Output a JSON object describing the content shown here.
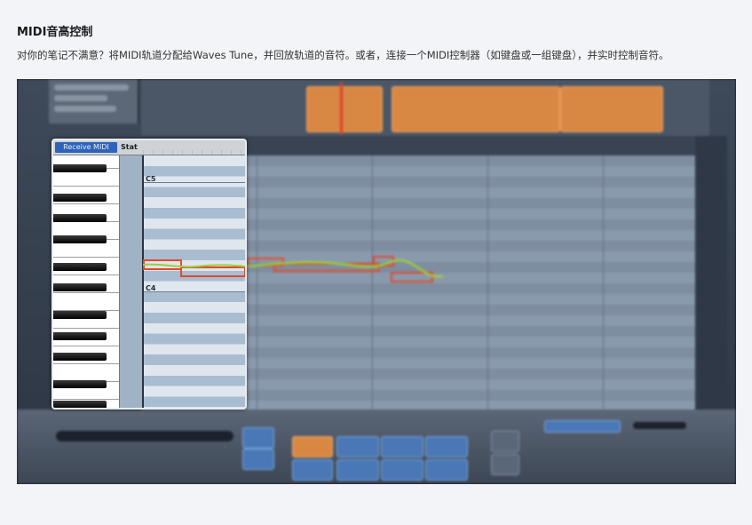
{
  "section": {
    "title": "MIDI音高控制",
    "description": "对你的笔记不满意？将MIDI轨道分配给Waves Tune，并回放轨道的音符。或者，连接一个MIDI控制器（如键盘或一组键盘），并实时控制音符。"
  },
  "screenshot": {
    "inset": {
      "receive_midi_label": "Receive MIDI",
      "stat_label": "Stat",
      "note_labels": [
        "C5",
        "C4"
      ]
    }
  },
  "colors": {
    "page_bg": "#f3f4f7",
    "receive_midi_bg": "#2e63b8",
    "note_orange": "#d98844",
    "pitch_curve": "#9ccf3a",
    "note_outline": "#e04a2a"
  }
}
